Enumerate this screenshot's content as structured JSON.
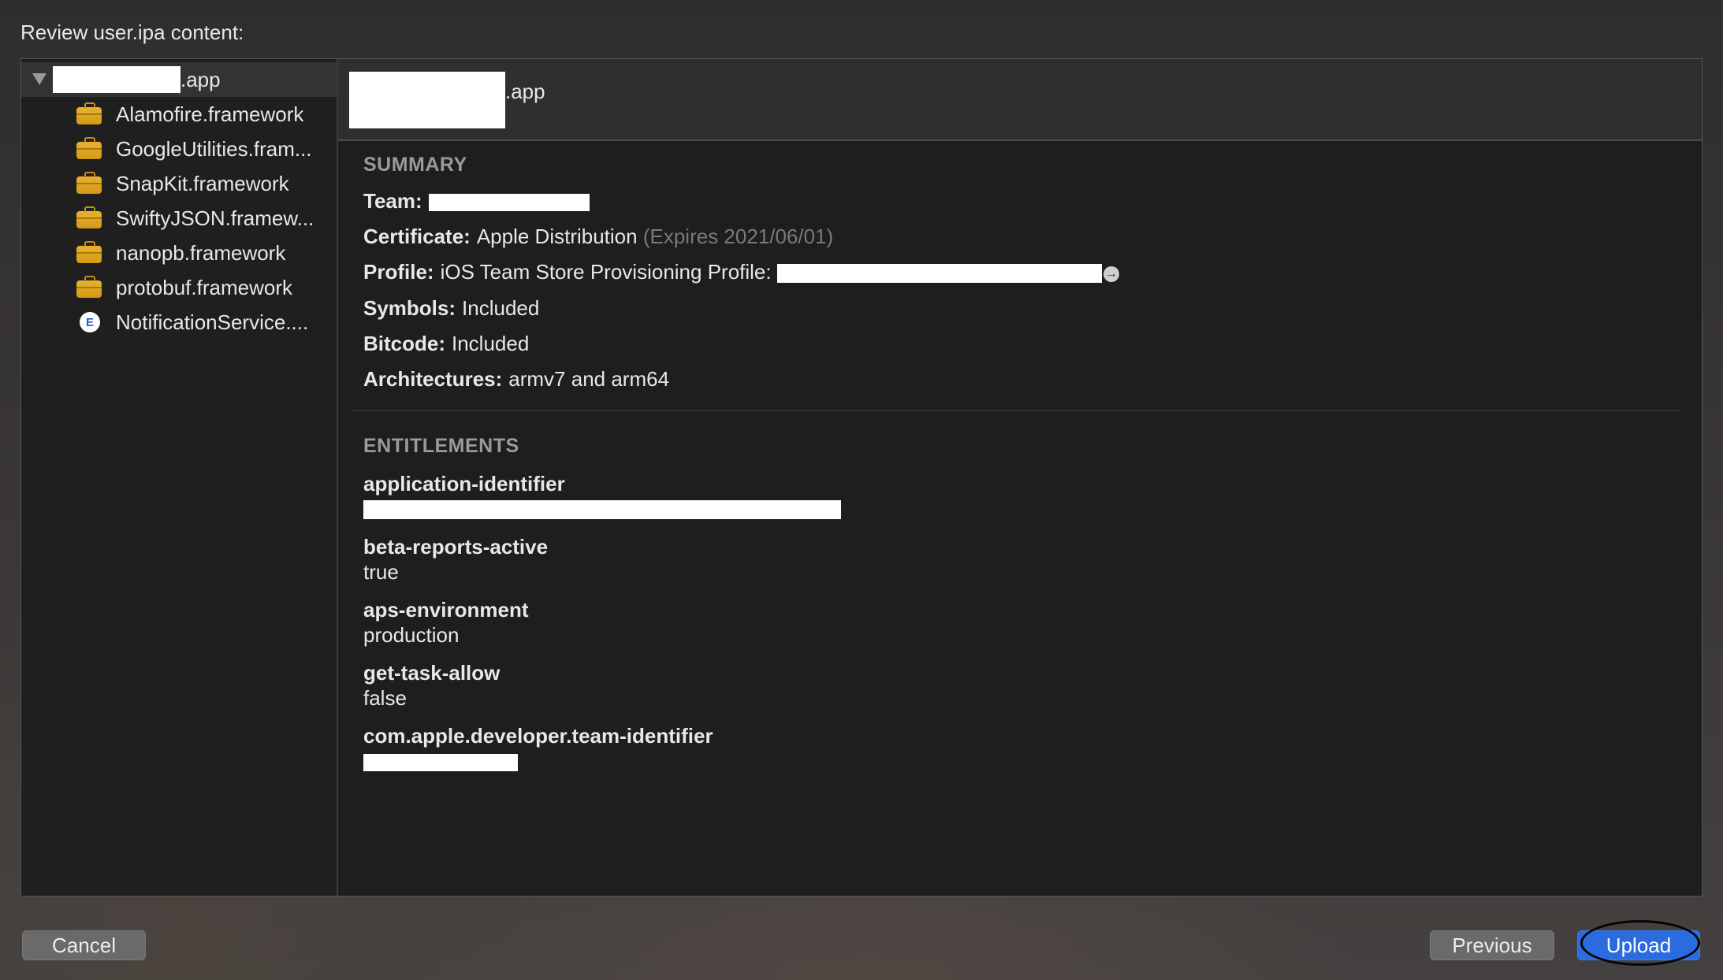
{
  "header": {
    "title": "Review user.ipa content:"
  },
  "sidebar": {
    "root": {
      "suffix": ".app"
    },
    "items": [
      {
        "label": "Alamofire.framework",
        "icon": "briefcase-icon"
      },
      {
        "label": "GoogleUtilities.fram...",
        "icon": "briefcase-icon"
      },
      {
        "label": "SnapKit.framework",
        "icon": "briefcase-icon"
      },
      {
        "label": "SwiftyJSON.framew...",
        "icon": "briefcase-icon"
      },
      {
        "label": "nanopb.framework",
        "icon": "briefcase-icon"
      },
      {
        "label": "protobuf.framework",
        "icon": "briefcase-icon"
      },
      {
        "label": "NotificationService....",
        "icon": "app-extension-icon",
        "icon_glyph": "E"
      }
    ]
  },
  "detail": {
    "app_suffix": ".app",
    "summary": {
      "label": "SUMMARY",
      "team_key": "Team:",
      "certificate_key": "Certificate:",
      "certificate_value": "Apple Distribution",
      "certificate_expiry": "(Expires 2021/06/01)",
      "profile_key": "Profile:",
      "profile_value": "iOS Team Store Provisioning Profile:",
      "symbols_key": "Symbols:",
      "symbols_value": "Included",
      "bitcode_key": "Bitcode:",
      "bitcode_value": "Included",
      "architectures_key": "Architectures:",
      "architectures_value": "armv7 and arm64"
    },
    "entitlements": {
      "label": "ENTITLEMENTS",
      "items": [
        {
          "key": "application-identifier",
          "value": ""
        },
        {
          "key": "beta-reports-active",
          "value": "true"
        },
        {
          "key": "aps-environment",
          "value": "production"
        },
        {
          "key": "get-task-allow",
          "value": "false"
        },
        {
          "key": "com.apple.developer.team-identifier",
          "value": ""
        }
      ]
    }
  },
  "footer": {
    "cancel_label": "Cancel",
    "previous_label": "Previous",
    "upload_label": "Upload"
  },
  "colors": {
    "accent": "#2b6be0",
    "briefcase": "#e0a624"
  }
}
